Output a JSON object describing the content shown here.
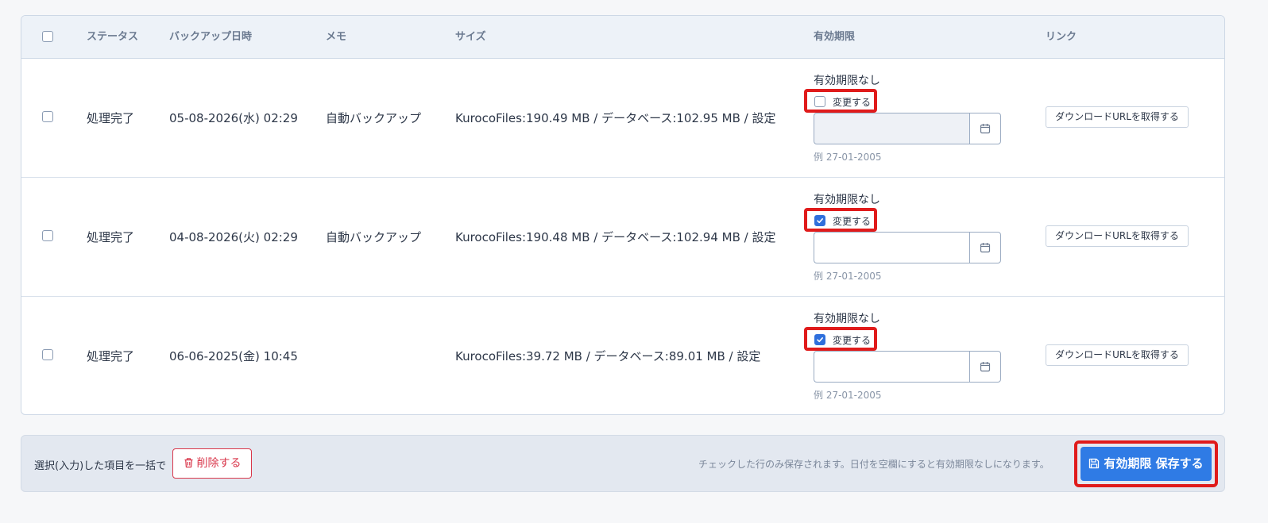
{
  "table": {
    "headers": {
      "status": "ステータス",
      "backup_datetime": "バックアップ日時",
      "memo": "メモ",
      "size": "サイズ",
      "expiry": "有効期限",
      "link": "リンク"
    },
    "rows": [
      {
        "selected": false,
        "status": "処理完了",
        "datetime": "05-08-2026(水) 02:29",
        "memo": "自動バックアップ",
        "size": "KurocoFiles:190.49 MB / データベース:102.95 MB / 設定",
        "expiry_text": "有効期限なし",
        "change_label": "変更する",
        "change_checked": false,
        "date_value": "",
        "date_disabled": true,
        "date_hint": "例 27-01-2005",
        "link_label": "ダウンロードURLを取得する"
      },
      {
        "selected": false,
        "status": "処理完了",
        "datetime": "04-08-2026(火) 02:29",
        "memo": "自動バックアップ",
        "size": "KurocoFiles:190.48 MB / データベース:102.94 MB / 設定",
        "expiry_text": "有効期限なし",
        "change_label": "変更する",
        "change_checked": true,
        "date_value": "",
        "date_disabled": false,
        "date_hint": "例 27-01-2005",
        "link_label": "ダウンロードURLを取得する"
      },
      {
        "selected": false,
        "status": "処理完了",
        "datetime": "06-06-2025(金) 10:45",
        "memo": "",
        "size": "KurocoFiles:39.72 MB / データベース:89.01 MB / 設定",
        "expiry_text": "有効期限なし",
        "change_label": "変更する",
        "change_checked": true,
        "date_value": "",
        "date_disabled": false,
        "date_hint": "例 27-01-2005",
        "link_label": "ダウンロードURLを取得する"
      }
    ]
  },
  "footer": {
    "bulk_label": "選択(入力)した項目を一括で",
    "delete_label": "削除する",
    "note": "チェックした行のみ保存されます。日付を空欄にすると有効期限なしになります。",
    "save_label": "有効期限 保存する"
  },
  "colors": {
    "primary": "#2f7be5",
    "danger": "#d9374b",
    "highlight": "#e01b1b",
    "header_bg": "#edf2f8",
    "footer_bg": "#e3e8f0"
  },
  "icons": {
    "calendar": "calendar-icon",
    "trash": "trash-icon",
    "save": "save-icon",
    "check": "check-icon"
  }
}
